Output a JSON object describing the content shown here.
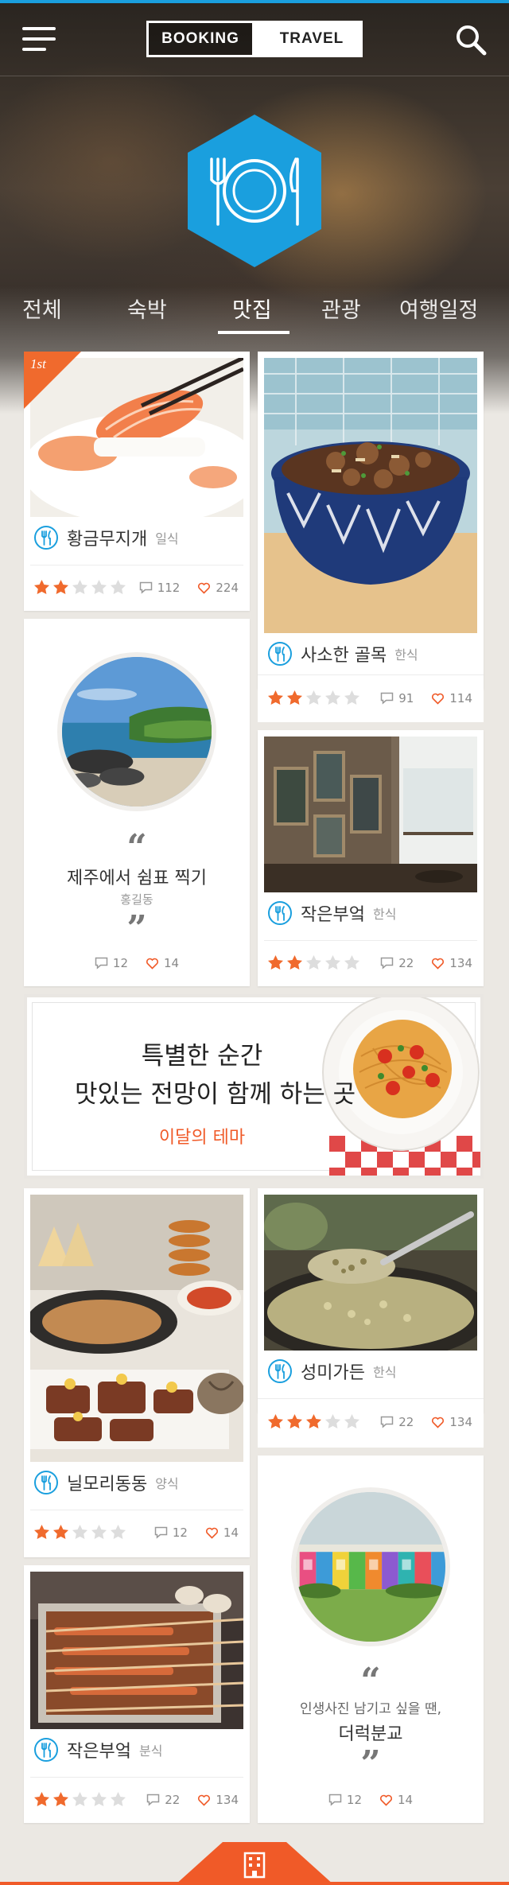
{
  "header": {
    "logo_left": "BOOKING",
    "logo_right": "TRAVEL"
  },
  "tabs": [
    {
      "label": "전체"
    },
    {
      "label": "숙박"
    },
    {
      "label": "맛집",
      "active": true
    },
    {
      "label": "관광"
    },
    {
      "label": "여행일정"
    }
  ],
  "colors": {
    "accent_blue": "#1a9fde",
    "accent_orange": "#f05a28",
    "star_on": "#f06a2d",
    "star_off": "#dddddd"
  },
  "cards": {
    "c1": {
      "rank": "1st",
      "name": "황금무지개",
      "category": "일식",
      "rating": 2,
      "comments": "112",
      "likes": "224"
    },
    "c2": {
      "name": "사소한 골목",
      "category": "한식",
      "rating": 2,
      "comments": "91",
      "likes": "114"
    },
    "q1": {
      "title": "제주에서 쉼표 찍기",
      "author": "홍길동",
      "comments": "12",
      "likes": "14"
    },
    "c3": {
      "name": "작은부엌",
      "category": "한식",
      "rating": 2,
      "comments": "22",
      "likes": "134"
    },
    "c4": {
      "name": "닐모리동동",
      "category": "양식",
      "rating": 2,
      "comments": "12",
      "likes": "14"
    },
    "c5": {
      "name": "성미가든",
      "category": "한식",
      "rating": 3,
      "comments": "22",
      "likes": "134"
    },
    "c6": {
      "name": "작은부엌",
      "category": "분식",
      "rating": 2,
      "comments": "22",
      "likes": "134"
    },
    "q2": {
      "line1": "인생사진 남기고 싶을 땐,",
      "title": "더럭분교",
      "comments": "12",
      "likes": "14"
    }
  },
  "banner": {
    "line1": "특별한 순간",
    "line2": "맛있는 전망이 함께 하는 곳",
    "link": "이달의 테마"
  },
  "icons": {
    "menu": "hamburger-menu-icon",
    "search": "search-icon",
    "category": "utensils-icon",
    "comment": "comment-icon",
    "like": "heart-icon",
    "bottom": "building-icon"
  }
}
